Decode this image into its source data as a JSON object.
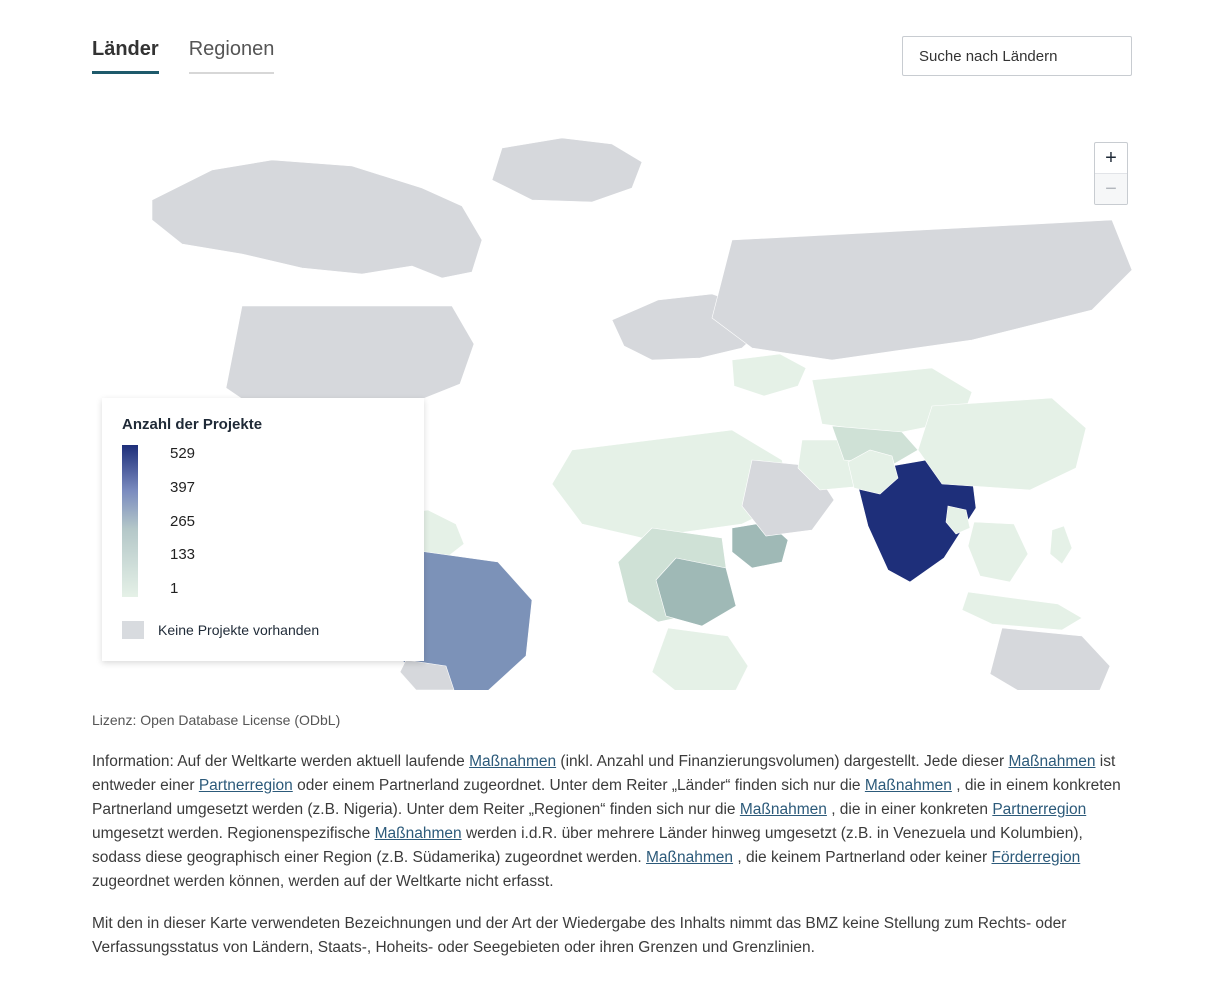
{
  "tabs": [
    {
      "label": "Länder",
      "active": true
    },
    {
      "label": "Regionen",
      "active": false
    }
  ],
  "search": {
    "placeholder": "Suche nach Ländern"
  },
  "zoom": {
    "in_enabled": true,
    "out_enabled": false
  },
  "legend": {
    "title": "Anzahl der Projekte",
    "ticks": [
      "529",
      "397",
      "265",
      "133",
      "1"
    ],
    "no_data_label": "Keine Projekte vorhanden",
    "scale_colors": {
      "max": "#1e2f7a",
      "min": "#e5f1e7",
      "none": "#d6d8dc"
    }
  },
  "license": "Lizenz: Open Database License (ODbL)",
  "info": {
    "links": {
      "massnahmen": "Maßnahmen",
      "partnerregion": "Partnerregion",
      "foerderregion": "Förderregion"
    },
    "parts": [
      "Information: Auf der Weltkarte werden aktuell laufende ",
      " (inkl. Anzahl und Finanzierungsvolumen) dargestellt. Jede dieser ",
      " ist entweder einer ",
      " oder einem Partnerland zugeordnet. Unter dem Reiter „Länder“ finden sich nur die ",
      ", die in einem konkreten Partnerland umgesetzt werden (z.B. Nigeria). Unter dem Reiter „Regionen“ finden sich nur die ",
      ", die in einer konkreten ",
      " umgesetzt werden. Regionenspezifische ",
      " werden i.d.R. über mehrere Länder hinweg umgesetzt (z.B. in Venezuela und Kolumbien), sodass diese geographisch einer Region (z.B. Südamerika) zugeordnet werden. ",
      ", die keinem Partnerland oder keiner ",
      " zugeordnet werden können, werden auf der Weltkarte nicht erfasst."
    ]
  },
  "disclaimer": "Mit den in dieser Karte verwendeten Bezeichnungen und der Art der Wiedergabe des Inhalts nimmt das BMZ keine Stellung zum Rechts- oder Verfassungsstatus von Ländern, Staats-, Hoheits- oder Seegebieten oder ihren Grenzen und Grenzlinien.",
  "chart_data": {
    "type": "choropleth-map",
    "metric": "Anzahl der Projekte",
    "value_range": [
      1,
      529
    ],
    "color_scale": {
      "1": "#e5f1e7",
      "133": "#cfe1d6",
      "265": "#9fb9b6",
      "397": "#7c92b8",
      "529": "#1e2f7a",
      "no_data": "#d6d8dc"
    },
    "legend_ticks": [
      529,
      397,
      265,
      133,
      1
    ],
    "highlighted_regions_estimated": [
      {
        "region": "India",
        "value": 529,
        "color_bucket": "max"
      },
      {
        "region": "Brazil",
        "value": 300,
        "color_bucket": "high"
      },
      {
        "region": "Ethiopia",
        "value": 200,
        "color_bucket": "mid"
      },
      {
        "region": "DR Congo",
        "value": 200,
        "color_bucket": "mid"
      },
      {
        "region": "Ukraine",
        "value": 80,
        "color_bucket": "low"
      },
      {
        "region": "Kazakhstan",
        "value": 60,
        "color_bucket": "low"
      },
      {
        "region": "China",
        "value": 60,
        "color_bucket": "low"
      },
      {
        "region": "Mexico",
        "value": 60,
        "color_bucket": "low"
      },
      {
        "region": "North Africa",
        "value": 60,
        "color_bucket": "low"
      },
      {
        "region": "Southeast Asia",
        "value": 60,
        "color_bucket": "low"
      },
      {
        "region": "North America",
        "value": null,
        "color_bucket": "no_data"
      },
      {
        "region": "Russia",
        "value": null,
        "color_bucket": "no_data"
      },
      {
        "region": "Western Europe",
        "value": null,
        "color_bucket": "no_data"
      },
      {
        "region": "Australia",
        "value": null,
        "color_bucket": "no_data"
      },
      {
        "region": "Arabian Peninsula",
        "value": null,
        "color_bucket": "no_data"
      }
    ]
  }
}
